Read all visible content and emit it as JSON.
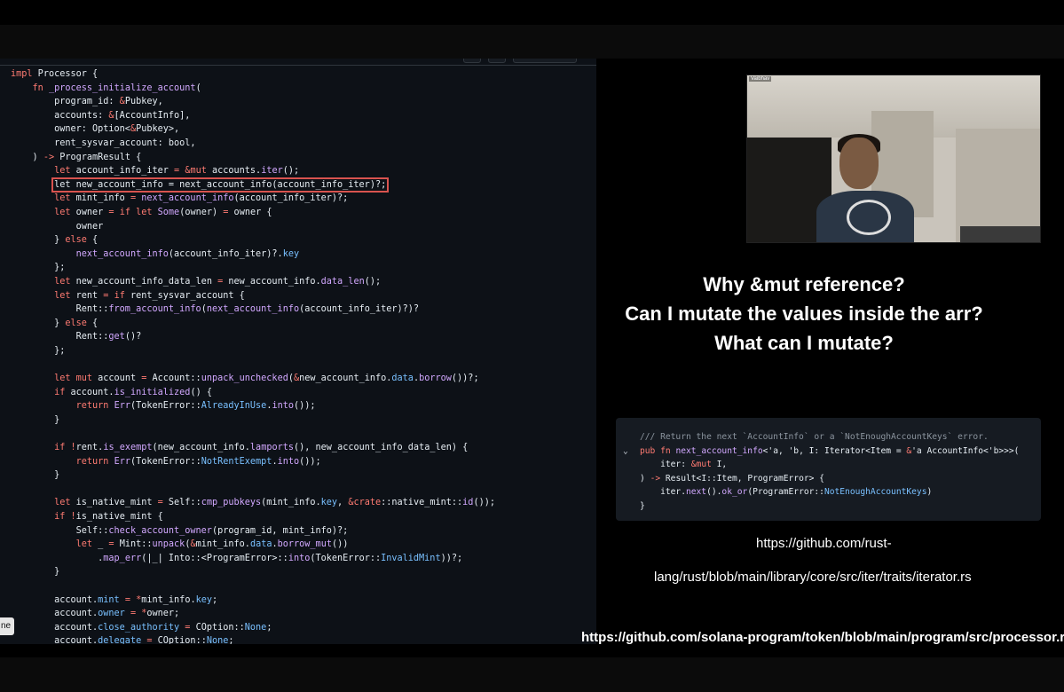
{
  "code": {
    "lines": [
      [
        {
          "t": "impl",
          "c": "kw"
        },
        {
          "t": " Processor {"
        }
      ],
      [
        {
          "t": "    "
        },
        {
          "t": "fn",
          "c": "kw"
        },
        {
          "t": " "
        },
        {
          "t": "_process_initialize_account",
          "c": "fn"
        },
        {
          "t": "("
        }
      ],
      [
        {
          "t": "        program_id: "
        },
        {
          "t": "&",
          "c": "kw"
        },
        {
          "t": "Pubkey,"
        }
      ],
      [
        {
          "t": "        accounts: "
        },
        {
          "t": "&",
          "c": "kw"
        },
        {
          "t": "[AccountInfo],"
        }
      ],
      [
        {
          "t": "        owner: Option<"
        },
        {
          "t": "&",
          "c": "kw"
        },
        {
          "t": "Pubkey>,"
        }
      ],
      [
        {
          "t": "        rent_sysvar_account: bool,"
        }
      ],
      [
        {
          "t": "    ) "
        },
        {
          "t": "->",
          "c": "kw"
        },
        {
          "t": " ProgramResult {"
        }
      ],
      [
        {
          "t": "        "
        },
        {
          "t": "let",
          "c": "kw"
        },
        {
          "t": " account_info_iter "
        },
        {
          "t": "=",
          "c": "kw"
        },
        {
          "t": " "
        },
        {
          "t": "&mut",
          "c": "kw"
        },
        {
          "t": " accounts."
        },
        {
          "t": "iter",
          "c": "fn"
        },
        {
          "t": "();"
        }
      ],
      [
        {
          "t": "        "
        },
        {
          "t": "let new_account_info = next_account_info(account_info_iter)?;",
          "c": "hlseg"
        }
      ],
      [
        {
          "t": "        "
        },
        {
          "t": "let",
          "c": "kw"
        },
        {
          "t": " mint_info "
        },
        {
          "t": "=",
          "c": "kw"
        },
        {
          "t": " "
        },
        {
          "t": "next_account_info",
          "c": "fn"
        },
        {
          "t": "(account_info_iter)?;"
        }
      ],
      [
        {
          "t": "        "
        },
        {
          "t": "let",
          "c": "kw"
        },
        {
          "t": " owner "
        },
        {
          "t": "=",
          "c": "kw"
        },
        {
          "t": " "
        },
        {
          "t": "if let",
          "c": "kw"
        },
        {
          "t": " "
        },
        {
          "t": "Some",
          "c": "fn"
        },
        {
          "t": "(owner) "
        },
        {
          "t": "=",
          "c": "kw"
        },
        {
          "t": " owner {"
        }
      ],
      [
        {
          "t": "            owner"
        }
      ],
      [
        {
          "t": "        } "
        },
        {
          "t": "else",
          "c": "kw"
        },
        {
          "t": " {"
        }
      ],
      [
        {
          "t": "            "
        },
        {
          "t": "next_account_info",
          "c": "fn"
        },
        {
          "t": "(account_info_iter)?."
        },
        {
          "t": "key",
          "c": "pr"
        }
      ],
      [
        {
          "t": "        };"
        }
      ],
      [
        {
          "t": "        "
        },
        {
          "t": "let",
          "c": "kw"
        },
        {
          "t": " new_account_info_data_len "
        },
        {
          "t": "=",
          "c": "kw"
        },
        {
          "t": " new_account_info."
        },
        {
          "t": "data_len",
          "c": "fn"
        },
        {
          "t": "();"
        }
      ],
      [
        {
          "t": "        "
        },
        {
          "t": "let",
          "c": "kw"
        },
        {
          "t": " rent "
        },
        {
          "t": "=",
          "c": "kw"
        },
        {
          "t": " "
        },
        {
          "t": "if",
          "c": "kw"
        },
        {
          "t": " rent_sysvar_account {"
        }
      ],
      [
        {
          "t": "            Rent::"
        },
        {
          "t": "from_account_info",
          "c": "fn"
        },
        {
          "t": "("
        },
        {
          "t": "next_account_info",
          "c": "fn"
        },
        {
          "t": "(account_info_iter)?)?"
        }
      ],
      [
        {
          "t": "        } "
        },
        {
          "t": "else",
          "c": "kw"
        },
        {
          "t": " {"
        }
      ],
      [
        {
          "t": "            Rent::"
        },
        {
          "t": "get",
          "c": "fn"
        },
        {
          "t": "()?"
        }
      ],
      [
        {
          "t": "        };"
        }
      ],
      [
        {
          "t": ""
        }
      ],
      [
        {
          "t": "        "
        },
        {
          "t": "let mut",
          "c": "kw"
        },
        {
          "t": " account "
        },
        {
          "t": "=",
          "c": "kw"
        },
        {
          "t": " Account::"
        },
        {
          "t": "unpack_unchecked",
          "c": "fn"
        },
        {
          "t": "("
        },
        {
          "t": "&",
          "c": "kw"
        },
        {
          "t": "new_account_info."
        },
        {
          "t": "data",
          "c": "pr"
        },
        {
          "t": "."
        },
        {
          "t": "borrow",
          "c": "fn"
        },
        {
          "t": "())?;"
        }
      ],
      [
        {
          "t": "        "
        },
        {
          "t": "if",
          "c": "kw"
        },
        {
          "t": " account."
        },
        {
          "t": "is_initialized",
          "c": "fn"
        },
        {
          "t": "() {"
        }
      ],
      [
        {
          "t": "            "
        },
        {
          "t": "return",
          "c": "kw"
        },
        {
          "t": " "
        },
        {
          "t": "Err",
          "c": "fn"
        },
        {
          "t": "(TokenError::"
        },
        {
          "t": "AlreadyInUse",
          "c": "pr"
        },
        {
          "t": "."
        },
        {
          "t": "into",
          "c": "fn"
        },
        {
          "t": "());"
        }
      ],
      [
        {
          "t": "        }"
        }
      ],
      [
        {
          "t": ""
        }
      ],
      [
        {
          "t": "        "
        },
        {
          "t": "if",
          "c": "kw"
        },
        {
          "t": " "
        },
        {
          "t": "!",
          "c": "kw"
        },
        {
          "t": "rent."
        },
        {
          "t": "is_exempt",
          "c": "fn"
        },
        {
          "t": "(new_account_info."
        },
        {
          "t": "lamports",
          "c": "fn"
        },
        {
          "t": "(), new_account_info_data_len) {"
        }
      ],
      [
        {
          "t": "            "
        },
        {
          "t": "return",
          "c": "kw"
        },
        {
          "t": " "
        },
        {
          "t": "Err",
          "c": "fn"
        },
        {
          "t": "(TokenError::"
        },
        {
          "t": "NotRentExempt",
          "c": "pr"
        },
        {
          "t": "."
        },
        {
          "t": "into",
          "c": "fn"
        },
        {
          "t": "());"
        }
      ],
      [
        {
          "t": "        }"
        }
      ],
      [
        {
          "t": ""
        }
      ],
      [
        {
          "t": "        "
        },
        {
          "t": "let",
          "c": "kw"
        },
        {
          "t": " is_native_mint "
        },
        {
          "t": "=",
          "c": "kw"
        },
        {
          "t": " Self::"
        },
        {
          "t": "cmp_pubkeys",
          "c": "fn"
        },
        {
          "t": "(mint_info."
        },
        {
          "t": "key",
          "c": "pr"
        },
        {
          "t": ", "
        },
        {
          "t": "&crate",
          "c": "kw"
        },
        {
          "t": "::native_mint::"
        },
        {
          "t": "id",
          "c": "fn"
        },
        {
          "t": "());"
        }
      ],
      [
        {
          "t": "        "
        },
        {
          "t": "if",
          "c": "kw"
        },
        {
          "t": " "
        },
        {
          "t": "!",
          "c": "kw"
        },
        {
          "t": "is_native_mint {"
        }
      ],
      [
        {
          "t": "            Self::"
        },
        {
          "t": "check_account_owner",
          "c": "fn"
        },
        {
          "t": "(program_id, mint_info)?;"
        }
      ],
      [
        {
          "t": "            "
        },
        {
          "t": "let",
          "c": "kw"
        },
        {
          "t": " _ "
        },
        {
          "t": "=",
          "c": "kw"
        },
        {
          "t": " Mint::"
        },
        {
          "t": "unpack",
          "c": "fn"
        },
        {
          "t": "("
        },
        {
          "t": "&",
          "c": "kw"
        },
        {
          "t": "mint_info."
        },
        {
          "t": "data",
          "c": "pr"
        },
        {
          "t": "."
        },
        {
          "t": "borrow_mut",
          "c": "fn"
        },
        {
          "t": "())"
        }
      ],
      [
        {
          "t": "                ."
        },
        {
          "t": "map_err",
          "c": "fn"
        },
        {
          "t": "(|_| Into::<ProgramError>::"
        },
        {
          "t": "into",
          "c": "fn"
        },
        {
          "t": "(TokenError::"
        },
        {
          "t": "InvalidMint",
          "c": "pr"
        },
        {
          "t": "))?;"
        }
      ],
      [
        {
          "t": "        }"
        }
      ],
      [
        {
          "t": ""
        }
      ],
      [
        {
          "t": "        account."
        },
        {
          "t": "mint",
          "c": "pr"
        },
        {
          "t": " "
        },
        {
          "t": "=",
          "c": "kw"
        },
        {
          "t": " "
        },
        {
          "t": "*",
          "c": "kw"
        },
        {
          "t": "mint_info."
        },
        {
          "t": "key",
          "c": "pr"
        },
        {
          "t": ";"
        }
      ],
      [
        {
          "t": "        account."
        },
        {
          "t": "owner",
          "c": "pr"
        },
        {
          "t": " "
        },
        {
          "t": "=",
          "c": "kw"
        },
        {
          "t": " "
        },
        {
          "t": "*",
          "c": "kw"
        },
        {
          "t": "owner;"
        }
      ],
      [
        {
          "t": "        account."
        },
        {
          "t": "close_authority",
          "c": "pr"
        },
        {
          "t": " "
        },
        {
          "t": "=",
          "c": "kw"
        },
        {
          "t": " COption::"
        },
        {
          "t": "None",
          "c": "pr"
        },
        {
          "t": ";"
        }
      ],
      [
        {
          "t": "        account."
        },
        {
          "t": "delegate",
          "c": "pr"
        },
        {
          "t": " "
        },
        {
          "t": "=",
          "c": "kw"
        },
        {
          "t": " COption::"
        },
        {
          "t": "None",
          "c": "pr"
        },
        {
          "t": ";"
        }
      ]
    ]
  },
  "side_tab": "ne",
  "webcam": {
    "label": "Vaibhav"
  },
  "questions": [
    "Why &mut reference?",
    "Can I mutate the values inside the arr?",
    "What can I mutate?"
  ],
  "snippet": {
    "lines": [
      [
        {
          "t": "/// Return the next `AccountInfo` or a `NotEnoughAccountKeys` error.",
          "c": "cm"
        }
      ],
      [
        {
          "t": "pub fn",
          "c": "kw"
        },
        {
          "t": " "
        },
        {
          "t": "next_account_info",
          "c": "fn"
        },
        {
          "t": "<'a, 'b, I: Iterator<Item = "
        },
        {
          "t": "&",
          "c": "kw"
        },
        {
          "t": "'a AccountInfo<'b>>>("
        }
      ],
      [
        {
          "t": "    iter: "
        },
        {
          "t": "&mut",
          "c": "kw"
        },
        {
          "t": " I,"
        }
      ],
      [
        {
          "t": ") "
        },
        {
          "t": "->",
          "c": "kw"
        },
        {
          "t": " Result<I::Item, ProgramError> {"
        }
      ],
      [
        {
          "t": "    iter."
        },
        {
          "t": "next",
          "c": "fn"
        },
        {
          "t": "()."
        },
        {
          "t": "ok_or",
          "c": "fn"
        },
        {
          "t": "(ProgramError::"
        },
        {
          "t": "NotEnoughAccountKeys",
          "c": "pr"
        },
        {
          "t": ")"
        }
      ],
      [
        {
          "t": "}"
        }
      ]
    ],
    "chevron": "⌄"
  },
  "links": {
    "iterator_1": "https://github.com/rust-",
    "iterator_2": "lang/rust/blob/main/library/core/src/iter/traits/iterator.rs",
    "processor": "https://github.com/solana-program/token/blob/main/program/src/processor.rs"
  }
}
